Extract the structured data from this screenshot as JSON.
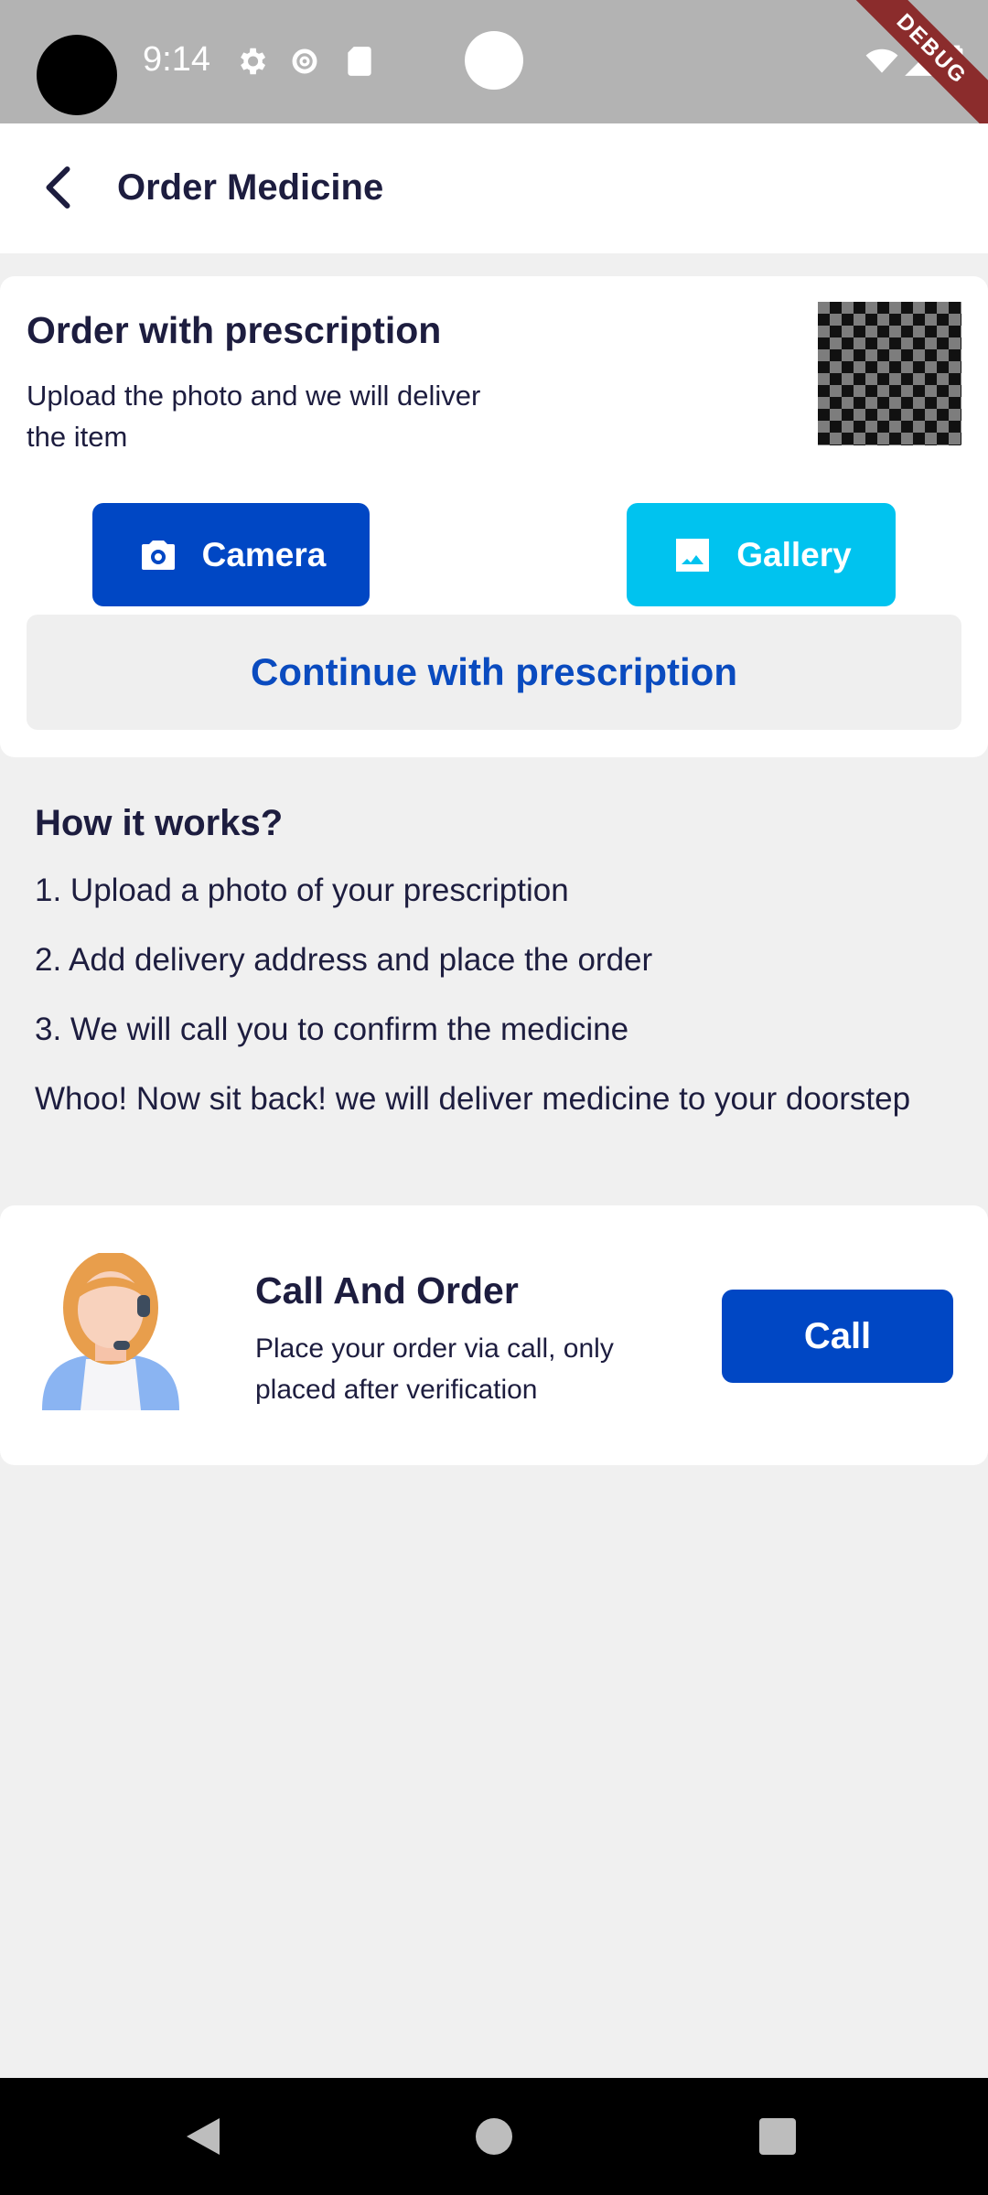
{
  "status_bar": {
    "time": "9:14",
    "ribbon": "DEBUG"
  },
  "app_bar": {
    "title": "Order Medicine"
  },
  "prescription_card": {
    "title": "Order with prescription",
    "description": "Upload the photo and we will deliver the item",
    "camera_label": "Camera",
    "gallery_label": "Gallery",
    "continue_label": "Continue with prescription"
  },
  "how_it_works": {
    "title": "How it works?",
    "steps": [
      "1. Upload a photo of your prescription",
      "2. Add delivery address and place the order",
      "3. We will call you to confirm the medicine",
      "Whoo! Now sit back! we will deliver medicine to your doorstep"
    ]
  },
  "call_card": {
    "title": "Call And Order",
    "description": "Place your order via call, only placed after verification",
    "call_label": "Call"
  },
  "colors": {
    "primary": "#0047c4",
    "accent": "#00c3ef",
    "text": "#1d1d3f"
  }
}
